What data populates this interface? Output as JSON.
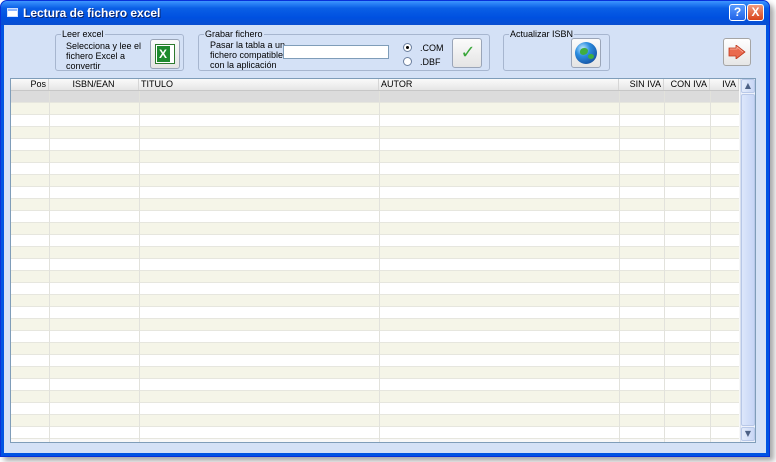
{
  "window": {
    "title": "Lectura de fichero excel",
    "help_label": "?",
    "close_label": "X"
  },
  "leer_excel": {
    "group_title": "Leer excel",
    "description_lines": [
      "Selecciona y lee el",
      "fichero Excel a",
      "convertir"
    ],
    "button_icon": "excel-icon"
  },
  "grabar_fichero": {
    "group_title": "Grabar fichero",
    "description_lines": [
      "Pasar la tabla a un",
      "fichero compatible",
      "con la aplicación"
    ],
    "filename_value": "",
    "options": [
      {
        "label": ".COM",
        "selected": true
      },
      {
        "label": ".DBF",
        "selected": false
      }
    ],
    "button_icon": "checkmark-icon"
  },
  "actualizar_isbn": {
    "group_title": "Actualizar ISBN",
    "button_icon": "globe-icon"
  },
  "exit_button": {
    "icon": "exit-arrow-icon",
    "color": "#e8563a"
  },
  "grid": {
    "columns": [
      "Pos",
      "ISBN/EAN",
      "TITULO",
      "AUTOR",
      "SIN IVA",
      "CON IVA",
      "IVA"
    ],
    "rows": []
  }
}
